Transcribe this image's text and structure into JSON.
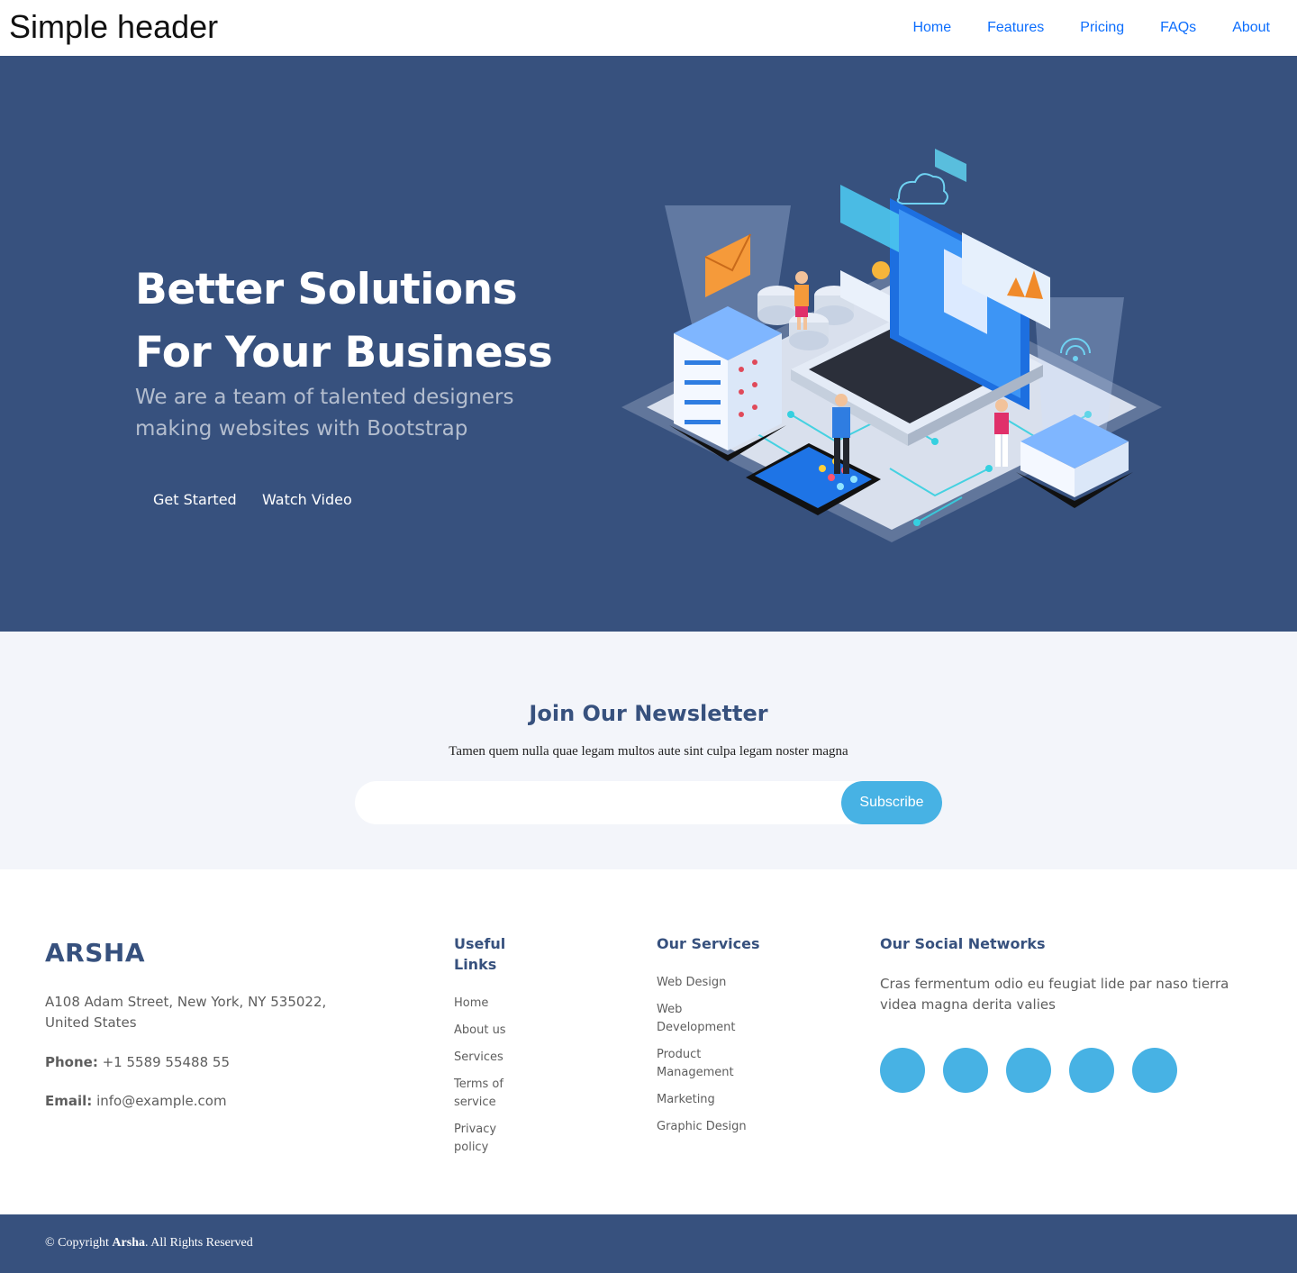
{
  "header": {
    "title": "Simple header",
    "nav": [
      "Home",
      "Features",
      "Pricing",
      "FAQs",
      "About"
    ]
  },
  "hero": {
    "title": "Better Solutions For Your Business",
    "subtitle": "We are a team of talented designers making websites with Bootstrap",
    "get_started": "Get Started",
    "watch_video": "Watch Video",
    "illustration_icon": "isometric-tech-illustration"
  },
  "newsletter": {
    "title": "Join Our Newsletter",
    "text": "Tamen quem nulla quae legam multos aute sint culpa legam noster magna",
    "input_value": "",
    "subscribe": "Subscribe"
  },
  "footer": {
    "brand": "ARSHA",
    "address": "A108 Adam Street, New York, NY 535022, United States",
    "phone_label": "Phone:",
    "phone": "+1 5589 55488 55",
    "email_label": "Email:",
    "email": "info@example.com",
    "useful_links_title": "Useful Links",
    "useful_links": [
      "Home",
      "About us",
      "Services",
      "Terms of service",
      "Privacy policy"
    ],
    "services_title": "Our Services",
    "services": [
      "Web Design",
      "Web Development",
      "Product Management",
      "Marketing",
      "Graphic Design"
    ],
    "social_title": "Our Social Networks",
    "social_text": "Cras fermentum odio eu feugiat lide par naso tierra videa magna derita valies",
    "social_icons": [
      "twitter-icon",
      "facebook-icon",
      "instagram-icon",
      "skype-icon",
      "linkedin-icon"
    ]
  },
  "copyright": {
    "prefix": "© Copyright",
    "brand": "Arsha",
    "suffix": ". All Rights Reserved"
  },
  "colors": {
    "primary": "#37517e",
    "accent": "#47b2e4",
    "nav_link": "#0d6efd",
    "newsletter_bg": "#f3f5fa"
  }
}
